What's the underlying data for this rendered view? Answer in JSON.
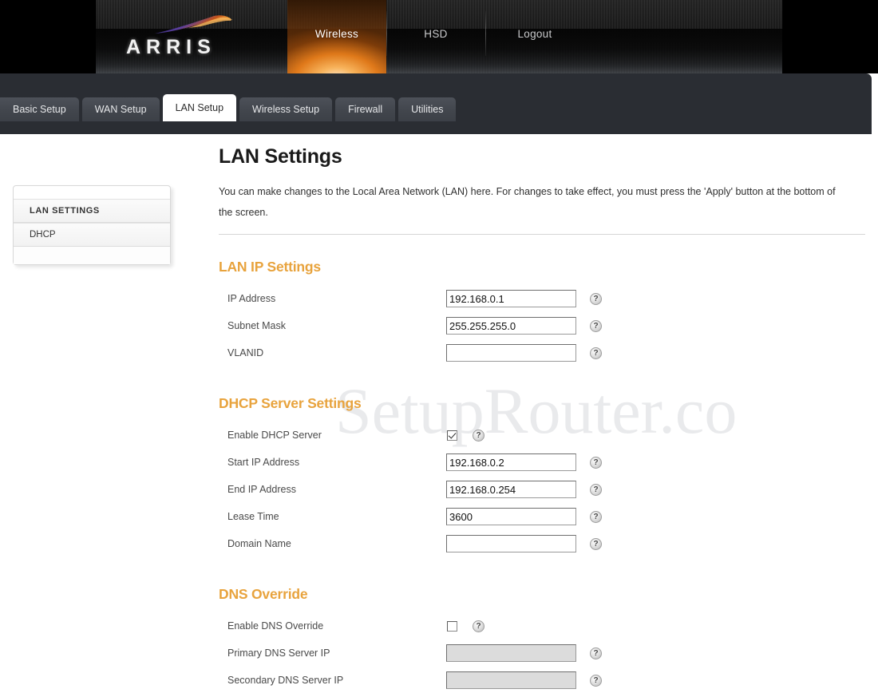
{
  "brand": {
    "logo_text": "ARRIS"
  },
  "topnav": {
    "items": [
      {
        "label": "Wireless",
        "active": true
      },
      {
        "label": "HSD",
        "active": false
      },
      {
        "label": "Logout",
        "active": false
      }
    ]
  },
  "tabs": [
    {
      "label": "Basic Setup",
      "active": false
    },
    {
      "label": "WAN Setup",
      "active": false
    },
    {
      "label": "LAN Setup",
      "active": true
    },
    {
      "label": "Wireless Setup",
      "active": false
    },
    {
      "label": "Firewall",
      "active": false
    },
    {
      "label": "Utilities",
      "active": false
    }
  ],
  "sidebar": {
    "items": [
      {
        "label": "LAN SETTINGS"
      },
      {
        "label": "DHCP"
      }
    ]
  },
  "watermark": "SetupRouter.co",
  "main": {
    "title": "LAN Settings",
    "description": "You can make changes to the Local Area Network (LAN) here. For changes to take effect, you must press the 'Apply' button at the bottom of the screen.",
    "help_glyph": "?",
    "sections": [
      {
        "title": "LAN IP Settings",
        "rows": [
          {
            "label": "IP Address",
            "type": "text",
            "value": "192.168.0.1",
            "disabled": false
          },
          {
            "label": "Subnet Mask",
            "type": "text",
            "value": "255.255.255.0",
            "disabled": false
          },
          {
            "label": "VLANID",
            "type": "text",
            "value": "",
            "disabled": false
          }
        ]
      },
      {
        "title": "DHCP Server Settings",
        "rows": [
          {
            "label": "Enable DHCP Server",
            "type": "checkbox",
            "checked": true
          },
          {
            "label": "Start IP Address",
            "type": "text",
            "value": "192.168.0.2",
            "disabled": false
          },
          {
            "label": "End IP Address",
            "type": "text",
            "value": "192.168.0.254",
            "disabled": false
          },
          {
            "label": "Lease Time",
            "type": "text",
            "value": "3600",
            "disabled": false
          },
          {
            "label": "Domain Name",
            "type": "text",
            "value": "",
            "disabled": false
          }
        ]
      },
      {
        "title": "DNS Override",
        "rows": [
          {
            "label": "Enable DNS Override",
            "type": "checkbox",
            "checked": false
          },
          {
            "label": "Primary DNS Server IP",
            "type": "text",
            "value": "",
            "disabled": true
          },
          {
            "label": "Secondary DNS Server IP",
            "type": "text",
            "value": "",
            "disabled": true
          }
        ]
      }
    ]
  },
  "colors": {
    "accent_orange": "#e8a33d",
    "tabbar_bg": "#2a2d33",
    "active_nav": "#e97e1a"
  }
}
